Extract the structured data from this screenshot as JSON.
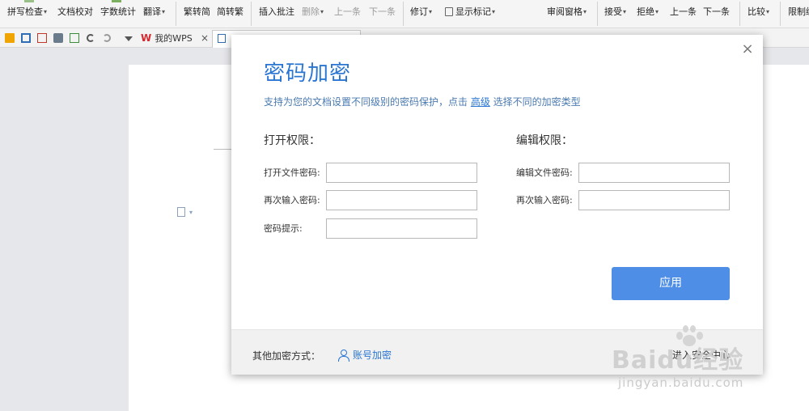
{
  "ribbon": {
    "items": [
      {
        "label": "拼写检查",
        "caret": true,
        "disabled": false
      },
      {
        "label": "文档校对",
        "caret": false,
        "disabled": false
      },
      {
        "label": "字数统计",
        "caret": false,
        "disabled": false
      },
      {
        "label": "翻译",
        "caret": true,
        "disabled": false
      },
      {
        "label": "繁转简",
        "caret": false,
        "disabled": false
      },
      {
        "label": "简转繁",
        "caret": false,
        "disabled": false
      },
      {
        "label": "插入批注",
        "caret": false,
        "disabled": false
      },
      {
        "label": "删除",
        "caret": true,
        "disabled": true
      },
      {
        "label": "上一条",
        "caret": false,
        "disabled": true
      },
      {
        "label": "下一条",
        "caret": false,
        "disabled": true
      },
      {
        "label": "修订",
        "caret": true,
        "disabled": false
      },
      {
        "label": "显示标记",
        "caret": true,
        "disabled": false
      },
      {
        "label": "审阅窗格",
        "caret": true,
        "disabled": false
      },
      {
        "label": "接受",
        "caret": true,
        "disabled": false
      },
      {
        "label": "拒绝",
        "caret": true,
        "disabled": false
      },
      {
        "label": "上一条",
        "caret": false,
        "disabled": false
      },
      {
        "label": "下一条",
        "caret": false,
        "disabled": false
      },
      {
        "label": "比较",
        "caret": true,
        "disabled": false
      },
      {
        "label": "限制编",
        "caret": false,
        "disabled": false
      }
    ],
    "caret_glyph": "▾"
  },
  "tabs": {
    "home_label": "我的WPS",
    "home_logo": "W",
    "close_glyph": "×"
  },
  "dialog": {
    "title": "密码加密",
    "description_before": "支持为您的文档设置不同级别的密码保护，点击 ",
    "description_link": "高级",
    "description_after": " 选择不同的加密类型",
    "close_glyph": "×",
    "open_section": {
      "heading": "打开权限：",
      "password_label": "打开文件密码:",
      "confirm_label": "再次输入密码:",
      "hint_label": "密码提示:",
      "password_value": "",
      "confirm_value": "",
      "hint_value": ""
    },
    "edit_section": {
      "heading": "编辑权限：",
      "password_label": "编辑文件密码:",
      "confirm_label": "再次输入密码:",
      "password_value": "",
      "confirm_value": ""
    },
    "apply_label": "应用",
    "footer": {
      "other_label": "其他加密方式：",
      "account_label": "账号加密",
      "right_label": "进入安全中心"
    },
    "accent_color": "#2a76d2",
    "apply_color": "#4f8ee6"
  },
  "watermark": {
    "logo": "Baidu经验",
    "url": "jingyan.baidu.com"
  }
}
